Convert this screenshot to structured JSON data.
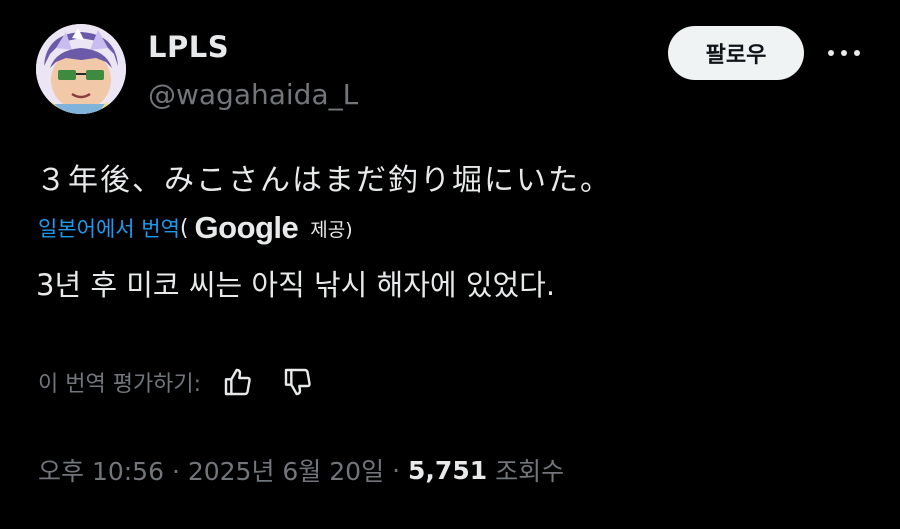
{
  "author": {
    "display_name": "LPLS",
    "handle": "@wagahaida_L"
  },
  "follow_label": "팔로우",
  "more_icon": "more-horizontal-icon",
  "tweet": {
    "original_text": "３年後、みこさんはまだ釣り堀にいた。",
    "translated_from": "일본어에서 번역",
    "paren_open": "(",
    "provider": "Google",
    "provided_label": "제공)",
    "translated_text": "3년 후 미코 씨는 아직 낚시 해자에 있었다."
  },
  "rating": {
    "label": "이 번역 평가하기:",
    "thumbs_up_icon": "thumbs-up-icon",
    "thumbs_down_icon": "thumbs-down-icon"
  },
  "meta": {
    "timestamp": "오후 10:56 · 2025년 6월 20일",
    "separator": "·",
    "view_count": "5,751",
    "view_label": "조회수"
  },
  "colors": {
    "background": "#000000",
    "text_primary": "#e7e9ea",
    "text_secondary": "#71767b",
    "link": "#1d9bf0",
    "follow_bg": "#eff3f4"
  }
}
